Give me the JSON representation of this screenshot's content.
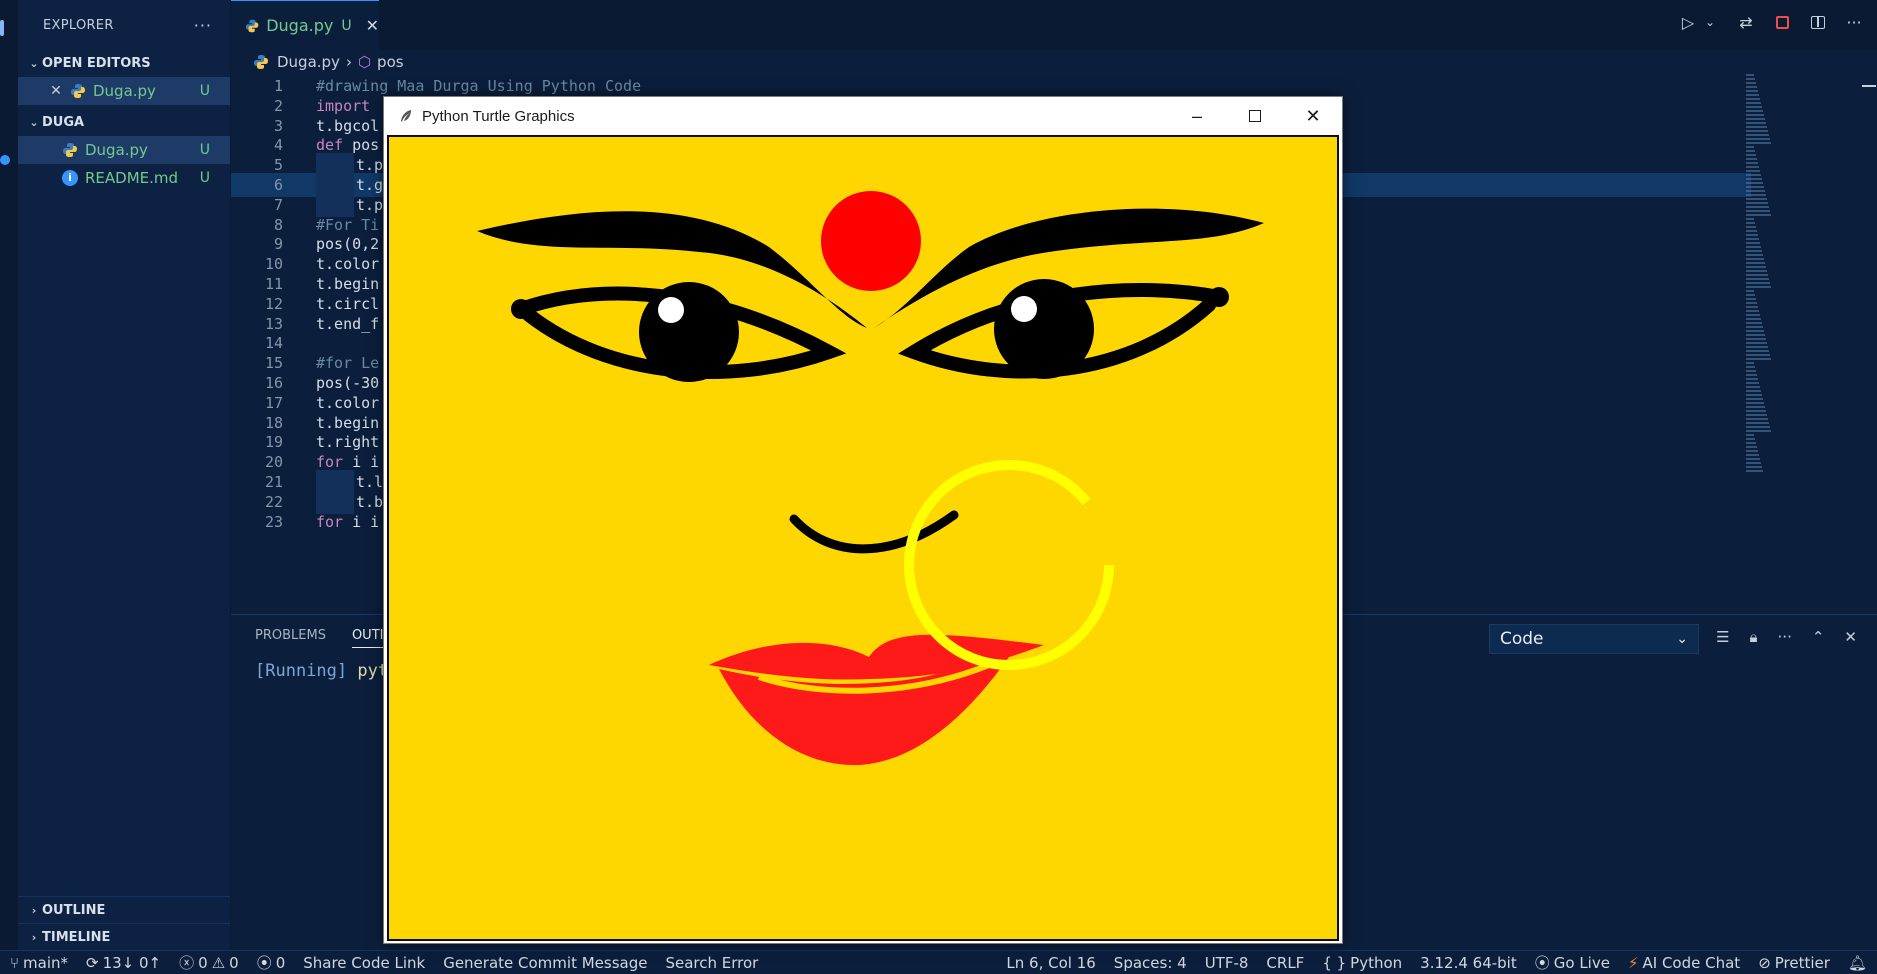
{
  "sidebar": {
    "title": "EXPLORER",
    "more": "···",
    "open_editors": {
      "title": "OPEN EDITORS",
      "items": [
        {
          "name": "Duga.py",
          "status": "U"
        }
      ]
    },
    "folder": {
      "title": "DUGA",
      "files": [
        {
          "name": "Duga.py",
          "status": "U",
          "icon": "python-icon"
        },
        {
          "name": "README.md",
          "status": "U",
          "icon": "info-icon"
        }
      ]
    },
    "outline": "OUTLINE",
    "timeline": "TIMELINE"
  },
  "tabs": [
    {
      "name": "Duga.py",
      "status": "U"
    }
  ],
  "breadcrumb": {
    "file": "Duga.py",
    "symbol": "pos"
  },
  "editor": {
    "lines": [
      {
        "n": "1",
        "text": "#drawing Maa Durga Using Python Code"
      },
      {
        "n": "2",
        "text": "import"
      },
      {
        "n": "3",
        "text": "t.bgcol"
      },
      {
        "n": "4",
        "text": "def pos"
      },
      {
        "n": "5",
        "text": "t.p"
      },
      {
        "n": "6",
        "text": "t.g"
      },
      {
        "n": "7",
        "text": "t.p"
      },
      {
        "n": "8",
        "text": "#For Ti"
      },
      {
        "n": "9",
        "text": "pos(0,2"
      },
      {
        "n": "10",
        "text": "t.color"
      },
      {
        "n": "11",
        "text": "t.begin"
      },
      {
        "n": "12",
        "text": "t.circl"
      },
      {
        "n": "13",
        "text": "t.end_f"
      },
      {
        "n": "14",
        "text": ""
      },
      {
        "n": "15",
        "text": "#for Le"
      },
      {
        "n": "16",
        "text": "pos(-30"
      },
      {
        "n": "17",
        "text": "t.color"
      },
      {
        "n": "18",
        "text": "t.begin"
      },
      {
        "n": "19",
        "text": "t.right"
      },
      {
        "n": "20",
        "text": "for i i"
      },
      {
        "n": "21",
        "text": "t.l"
      },
      {
        "n": "22",
        "text": "t.b"
      },
      {
        "n": "23",
        "text": "for i i"
      }
    ]
  },
  "panel": {
    "tabs": [
      "PROBLEMS",
      "OUTI"
    ],
    "select_value": "Code",
    "output_status": "[Running]",
    "output_cmd": "pyt"
  },
  "turtle_window": {
    "title": "Python Turtle Graphics",
    "canvas_colors": {
      "background": "#ffd700",
      "tilak": "#ff0000",
      "lips": "#ff1a1a",
      "nose_ring": "#ffff00",
      "ink": "#000000"
    }
  },
  "statusbar": {
    "branch": "main*",
    "sync": "13↓ 0↑",
    "errors": "0",
    "warnings": "0",
    "ports": "0",
    "share": "Share Code Link",
    "commit": "Generate Commit Message",
    "search_error": "Search Error",
    "position": "Ln 6, Col 16",
    "spaces": "Spaces: 4",
    "encoding": "UTF-8",
    "eol": "CRLF",
    "language": "Python",
    "interpreter": "3.12.4 64-bit",
    "golive": "Go Live",
    "aichat": "AI Code Chat",
    "prettier": "Prettier"
  },
  "colors": {
    "accent": "#3794ff",
    "git_untracked": "#73c991",
    "editor_bg": "#0b1f3d"
  }
}
